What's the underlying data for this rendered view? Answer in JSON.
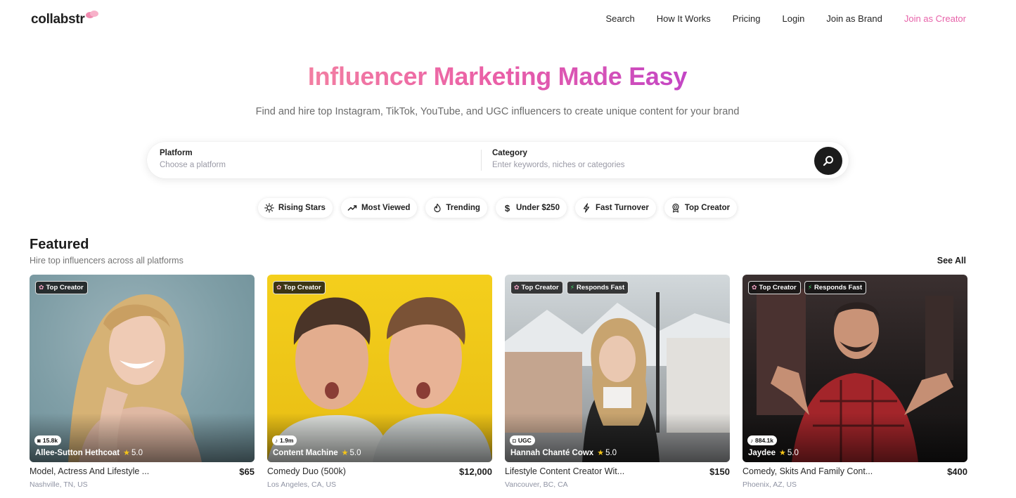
{
  "brand": {
    "name": "collabstr",
    "accent": "#e762a9"
  },
  "nav": {
    "links": [
      "Search",
      "How It Works",
      "Pricing",
      "Login",
      "Join as Brand",
      "Join as Creator"
    ]
  },
  "hero": {
    "title": "Influencer Marketing Made Easy",
    "subtitle": "Find and hire top Instagram, TikTok, YouTube, and UGC influencers to create unique content for your brand"
  },
  "search": {
    "platform_label": "Platform",
    "platform_placeholder": "Choose a platform",
    "category_label": "Category",
    "category_placeholder": "Enter keywords, niches or categories",
    "button_icon": "search-icon"
  },
  "filters": [
    {
      "label": "Rising Stars",
      "icon": "sun-icon"
    },
    {
      "label": "Most Viewed",
      "icon": "trending-up-icon"
    },
    {
      "label": "Trending",
      "icon": "flame-icon"
    },
    {
      "label": "Under $250",
      "icon": "dollar-icon"
    },
    {
      "label": "Fast Turnover",
      "icon": "bolt-icon"
    },
    {
      "label": "Top Creator",
      "icon": "ribbon-icon"
    }
  ],
  "featured": {
    "title": "Featured",
    "subtitle": "Hire top influencers across all platforms",
    "see_all": "See All",
    "cards": [
      {
        "badges": [
          "Top Creator"
        ],
        "platform_icon": "instagram-icon",
        "stat": "15.8k",
        "name": "Allee-Sutton Hethcoat",
        "rating": "5.0",
        "description": "Model, Actress And Lifestyle ...",
        "price": "$65",
        "location": "Nashville, TN, US"
      },
      {
        "badges": [
          "Top Creator"
        ],
        "platform_icon": "tiktok-icon",
        "stat": "1.9m",
        "name": "Content Machine",
        "rating": "5.0",
        "description": "Comedy Duo (500k)",
        "price": "$12,000",
        "location": "Los Angeles, CA, US"
      },
      {
        "badges": [
          "Top Creator",
          "Responds Fast"
        ],
        "platform_icon": "camera-icon",
        "stat": "UGC",
        "name": "Hannah Chanté Cowx",
        "rating": "5.0",
        "description": "Lifestyle Content Creator Wit...",
        "price": "$150",
        "location": "Vancouver, BC, CA"
      },
      {
        "badges": [
          "Top Creator",
          "Responds Fast"
        ],
        "platform_icon": "tiktok-icon",
        "stat": "884.1k",
        "name": "Jaydee",
        "rating": "5.0",
        "description": "Comedy, Skits And Family Cont...",
        "price": "$400",
        "location": "Phoenix, AZ, US"
      }
    ]
  }
}
